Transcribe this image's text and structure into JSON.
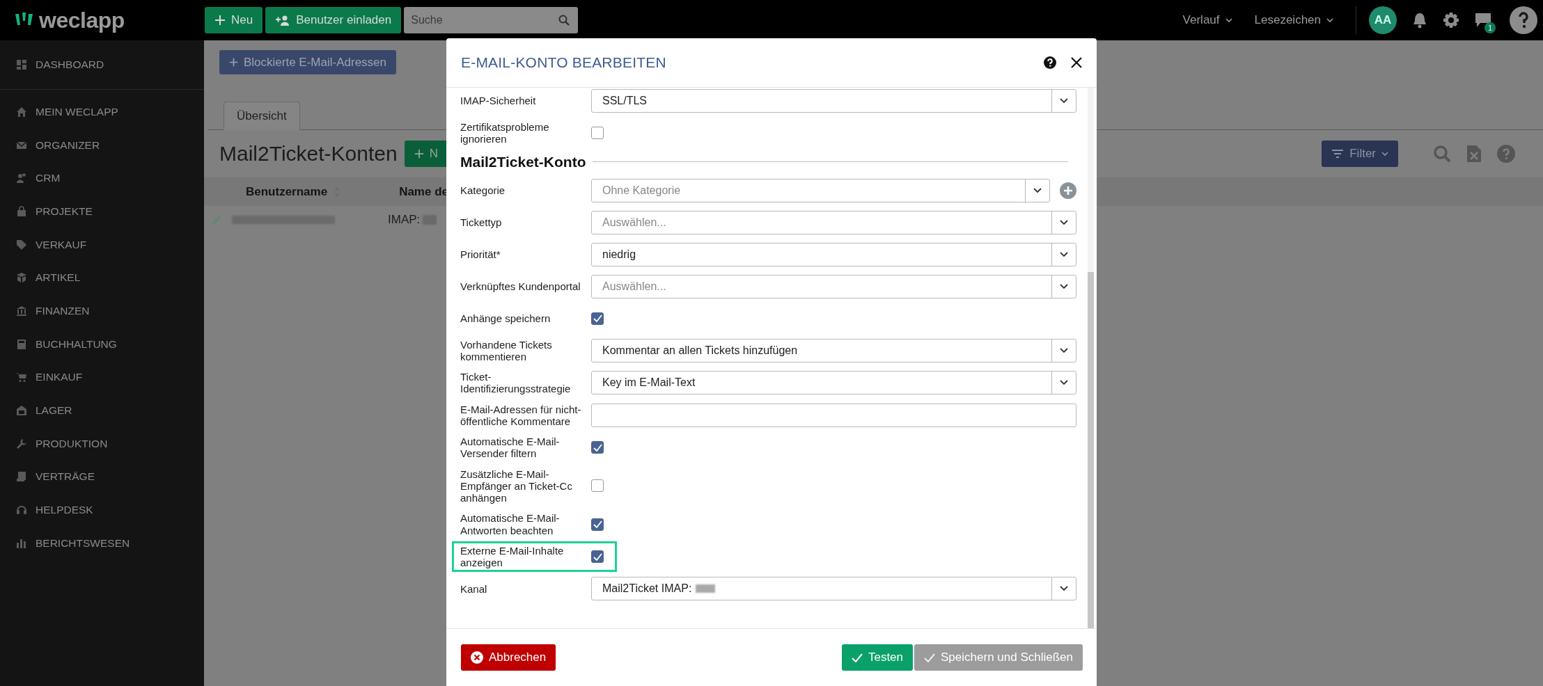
{
  "topbar": {
    "logo": "weclapp",
    "buttons": [
      {
        "label": "Neu",
        "kind": "new"
      },
      {
        "label": "Benutzer einladen",
        "kind": "invite"
      }
    ],
    "search": {
      "placeholder": "Suche"
    },
    "menus": [
      "Verlauf",
      "Lesezeichen"
    ],
    "avatar": "AA",
    "messages_badge": "1"
  },
  "sidebar": {
    "items": [
      {
        "label": "DASHBOARD"
      },
      {
        "label": "MEIN WECLAPP"
      },
      {
        "label": "ORGANIZER"
      },
      {
        "label": "CRM"
      },
      {
        "label": "PROJEKTE"
      },
      {
        "label": "VERKAUF"
      },
      {
        "label": "ARTIKEL"
      },
      {
        "label": "FINANZEN"
      },
      {
        "label": "BUCHHALTUNG"
      },
      {
        "label": "EINKAUF"
      },
      {
        "label": "LAGER"
      },
      {
        "label": "PRODUKTION"
      },
      {
        "label": "VERTRÄGE"
      },
      {
        "label": "HELPDESK"
      },
      {
        "label": "BERICHTSWESEN"
      }
    ]
  },
  "page": {
    "blocked_button": "Blockierte E-Mail-Adressen",
    "tabs": [
      {
        "label": "Übersicht",
        "selected": true
      }
    ],
    "title": "Mail2Ticket-Konten",
    "new_button": "N",
    "filter_button": "Filter",
    "columns": [
      "Benutzername",
      "Name de"
    ],
    "rows": [
      {
        "username_redacted": true,
        "name": "IMAP:",
        "name_redacted": true
      }
    ]
  },
  "dialog": {
    "title": "E-MAIL-KONTO BEARBEITEN",
    "fields": [
      {
        "kind": "select",
        "label": "IMAP-Sicherheit",
        "value": "SSL/TLS"
      },
      {
        "kind": "checkbox",
        "label": "Zertifikatsprobleme ignorieren",
        "checked": false
      },
      {
        "kind": "heading",
        "label": "Mail2Ticket-Konto"
      },
      {
        "kind": "select",
        "label": "Kategorie",
        "placeholder": "Ohne Kategorie",
        "add_button": true
      },
      {
        "kind": "select",
        "label": "Tickettyp",
        "placeholder": "Auswählen..."
      },
      {
        "kind": "select",
        "label": "Priorität*",
        "value": "niedrig"
      },
      {
        "kind": "select",
        "label": "Verknüpftes Kundenportal",
        "placeholder": "Auswählen..."
      },
      {
        "kind": "checkbox",
        "label": "Anhänge speichern",
        "checked": true
      },
      {
        "kind": "select",
        "label": "Vorhandene Tickets kommentieren",
        "value": "Kommentar an allen Tickets hinzufügen"
      },
      {
        "kind": "select",
        "label": "Ticket-Identifizierungsstrategie",
        "value": "Key im E-Mail-Text"
      },
      {
        "kind": "text",
        "label": "E-Mail-Adressen für nicht-öffentliche Kommentare"
      },
      {
        "kind": "checkbox",
        "label": "Automatische E-Mail-Versender filtern",
        "checked": true
      },
      {
        "kind": "checkbox",
        "label": "Zusätzliche E-Mail-Empfänger an Ticket-Cc anhängen",
        "checked": false
      },
      {
        "kind": "checkbox",
        "label": "Automatische E-Mail-Antworten beachten",
        "checked": true
      },
      {
        "kind": "checkbox",
        "label": "Externe E-Mail-Inhalte anzeigen",
        "checked": true,
        "highlighted": true
      },
      {
        "kind": "select",
        "label": "Kanal",
        "value": "Mail2Ticket IMAP:",
        "redacted": true
      }
    ],
    "buttons": [
      {
        "label": "Abbrechen",
        "kind": "cancel",
        "disabled": false
      },
      {
        "label": "Testen",
        "kind": "test",
        "disabled": false
      },
      {
        "label": "Speichern und Schließen",
        "kind": "save",
        "disabled": true
      }
    ]
  }
}
